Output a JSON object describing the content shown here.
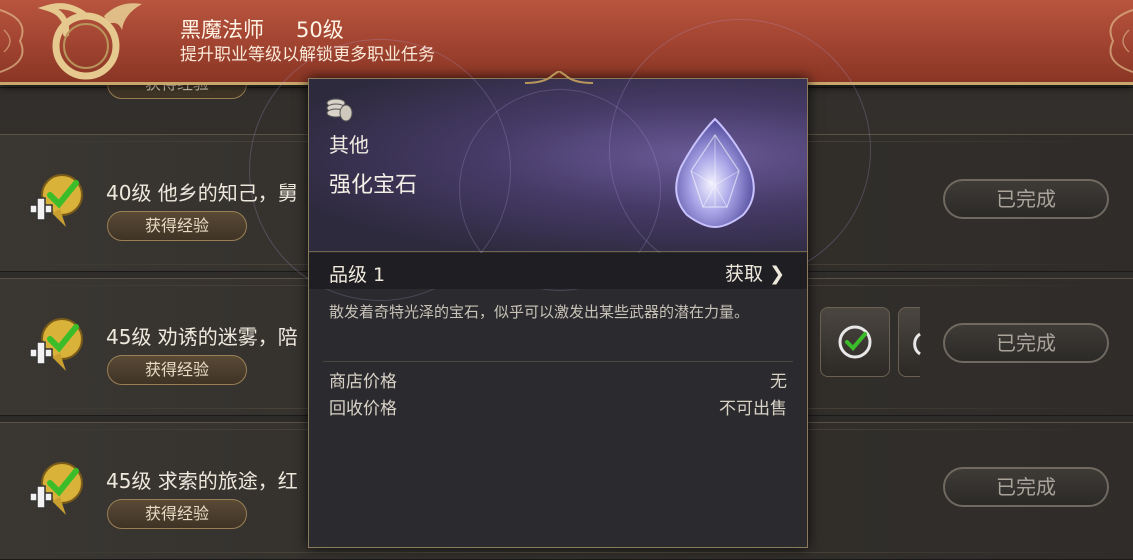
{
  "header": {
    "class_name": "黑魔法师",
    "class_level": "50级",
    "subtitle": "提升职业等级以解锁更多职业任务"
  },
  "quests": [
    {
      "title": "",
      "exp_label": "获得经验",
      "partial": true
    },
    {
      "title": "40级 他乡的知己，舅",
      "exp_label": "获得经验",
      "status": "已完成"
    },
    {
      "title": "45级 劝诱的迷雾，陪",
      "exp_label": "获得经验",
      "status": "已完成"
    },
    {
      "title": "45级 求索的旅途，红",
      "exp_label": "获得经验",
      "status": "已完成"
    }
  ],
  "tooltip": {
    "category": "其他",
    "item_name": "强化宝石",
    "grade": "品级 1",
    "obtain_label": "获取",
    "obtain_arrow": "❯",
    "description": "散发着奇特光泽的宝石，似乎可以激发出某些武器的潜在力量。",
    "shop_price_label": "商店价格",
    "shop_price_value": "无",
    "recycle_price_label": "回收价格",
    "recycle_price_value": "不可出售",
    "icon": "coin-stack-icon",
    "item_icon": "gem-icon"
  },
  "colors": {
    "banner": "#a04330",
    "banner_border": "#c9a66b",
    "tooltip_header": "#453a66",
    "check_green": "#3bbd2a",
    "gold": "#c9a66b"
  }
}
